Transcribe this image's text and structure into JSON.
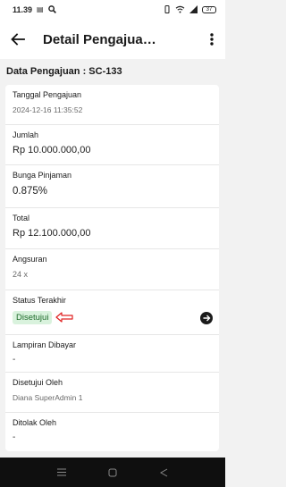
{
  "status_bar": {
    "time": "11.39",
    "battery": "37"
  },
  "app_bar": {
    "title": "Detail Pengajua…"
  },
  "section": {
    "title": "Data Pengajuan : SC-133"
  },
  "fields": {
    "tanggal": {
      "label": "Tanggal Pengajuan",
      "value": "2024-12-16 11:35:52"
    },
    "jumlah": {
      "label": "Jumlah",
      "value": "Rp 10.000.000,00"
    },
    "bunga": {
      "label": "Bunga Pinjaman",
      "value": "0.875%"
    },
    "total": {
      "label": "Total",
      "value": "Rp 12.100.000,00"
    },
    "angsuran": {
      "label": "Angsuran",
      "value": "24 x"
    },
    "status": {
      "label": "Status Terakhir",
      "value": "Disetujui"
    },
    "lampiran": {
      "label": "Lampiran Dibayar",
      "value": "-"
    },
    "disetujui_oleh": {
      "label": "Disetujui Oleh",
      "value": "Diana SuperAdmin 1"
    },
    "ditolak_oleh": {
      "label": "Ditolak Oleh",
      "value": "-"
    }
  },
  "icons": {
    "back": "arrow-left-icon",
    "more": "more-vertical-icon",
    "go": "arrow-right-circle-icon",
    "annotation": "red-arrow-annotation-icon"
  },
  "colors": {
    "badge_bg": "#d9f2dd",
    "badge_text": "#1e6b2a",
    "annotation": "#e02020",
    "nav_bar": "#0f0f0f"
  }
}
